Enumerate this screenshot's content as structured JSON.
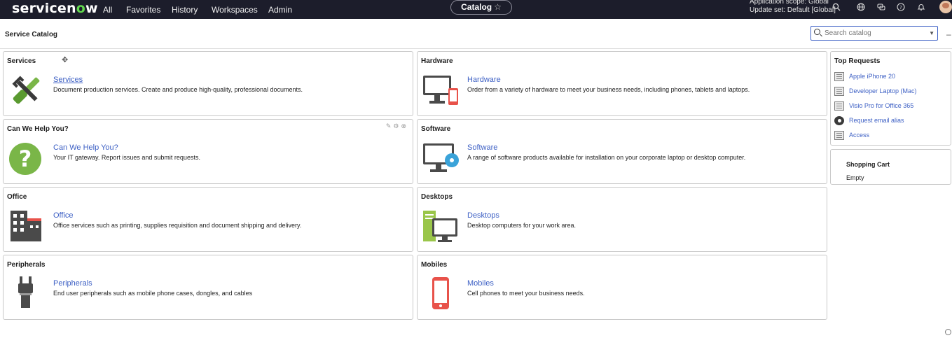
{
  "nav": {
    "logo_part1": "servicen",
    "logo_o": "o",
    "logo_part2": "w",
    "links": [
      "All",
      "Favorites",
      "History",
      "Workspaces",
      "Admin"
    ],
    "pill_label": "Catalog",
    "pill_star": "☆",
    "scope_line1": "Application scope: Global",
    "scope_line2": "Update set: Default [Global]"
  },
  "header": {
    "title": "Service Catalog",
    "search_placeholder": "Search catalog"
  },
  "cards": [
    {
      "title": "Services",
      "link": "Services",
      "desc": "Document production services. Create and produce high-quality, professional documents.",
      "icon": "tools-icon"
    },
    {
      "title": "Hardware",
      "link": "Hardware",
      "desc": "Order from a variety of hardware to meet your business needs, including phones, tablets and laptops.",
      "icon": "hardware-icon"
    },
    {
      "title": "Can We Help You?",
      "link": "Can We Help You?",
      "desc": "Your IT gateway. Report issues and submit requests.",
      "icon": "question-icon"
    },
    {
      "title": "Software",
      "link": "Software",
      "desc": "A range of software products available for installation on your corporate laptop or desktop computer.",
      "icon": "software-icon"
    },
    {
      "title": "Office",
      "link": "Office",
      "desc": "Office services such as printing, supplies requisition and document shipping and delivery.",
      "icon": "office-building-icon"
    },
    {
      "title": "Desktops",
      "link": "Desktops",
      "desc": "Desktop computers for your work area.",
      "icon": "desktop-icon"
    },
    {
      "title": "Peripherals",
      "link": "Peripherals",
      "desc": "End user peripherals such as mobile phone cases, dongles, and cables",
      "icon": "plug-icon"
    },
    {
      "title": "Mobiles",
      "link": "Mobiles",
      "desc": "Cell phones to meet your business needs.",
      "icon": "mobile-phone-icon"
    }
  ],
  "top_requests": {
    "title": "Top Requests",
    "items": [
      "Apple iPhone 20",
      "Developer Laptop (Mac)",
      "Visio Pro for Office 365",
      "Request email alias",
      "Access"
    ]
  },
  "cart": {
    "title": "Shopping Cart",
    "status": "Empty"
  },
  "colors": {
    "topbar": "#1c1d2b",
    "link": "#3c5fc4",
    "logo_accent": "#62d84e",
    "green_icon": "#7ab648",
    "red_icon": "#e8524a",
    "blue_icon": "#3aa3d9"
  }
}
